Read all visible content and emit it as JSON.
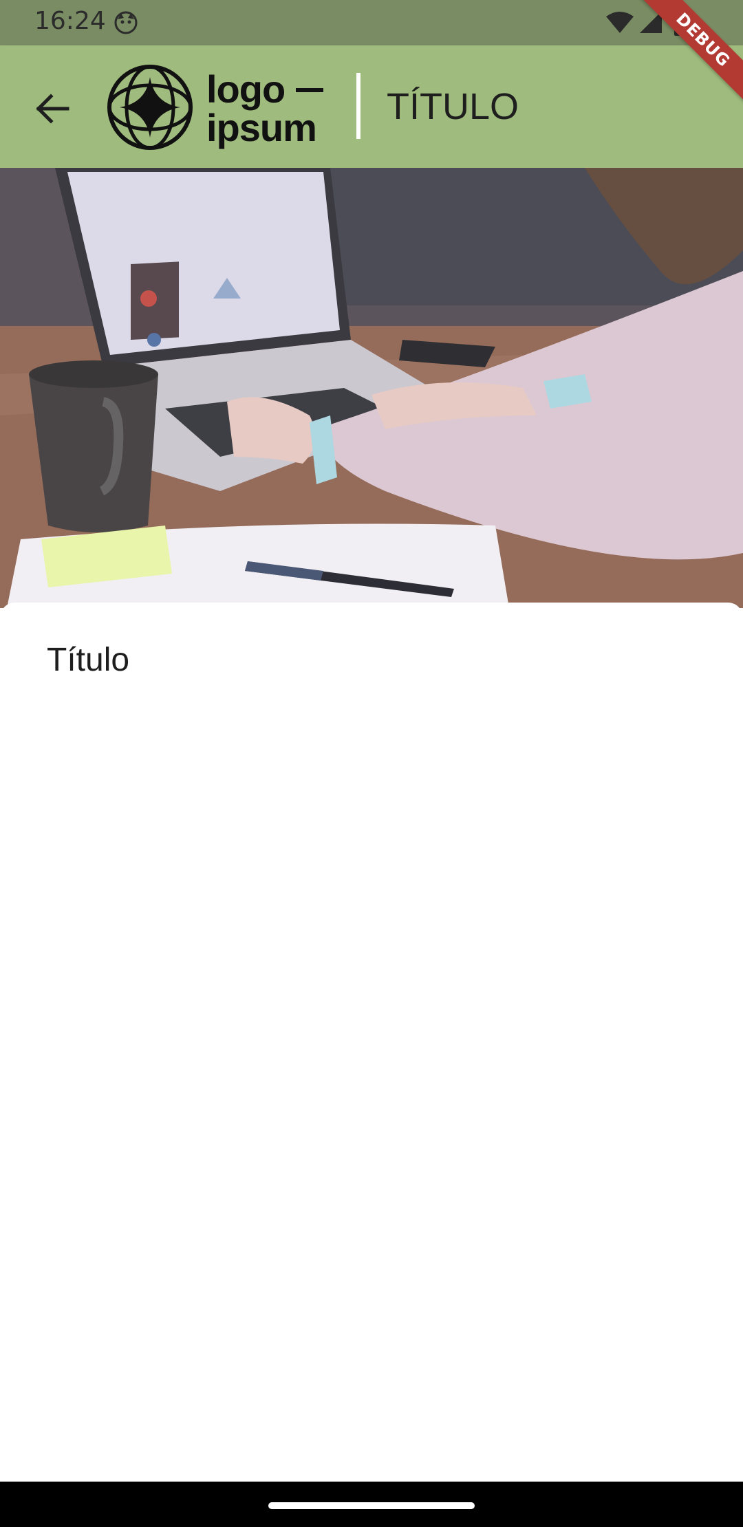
{
  "status_bar": {
    "time": "16:24",
    "icons": [
      "face-icon",
      "wifi-icon",
      "signal-icon",
      "battery-icon"
    ]
  },
  "debug_banner": {
    "label": "DEBUG",
    "color": "#b23a33"
  },
  "app_bar": {
    "back_icon": "arrow-left-icon",
    "logo": {
      "line1": "logo",
      "line2": "ipsum"
    },
    "title": "TÍTULO",
    "background": "#9fbb7d"
  },
  "hero": {
    "description_icon": "photo"
  },
  "content": {
    "title": "Título"
  },
  "colors": {
    "status_bar": "#7a8c63",
    "app_bar": "#9fbb7d",
    "text": "#1e1e1e"
  }
}
